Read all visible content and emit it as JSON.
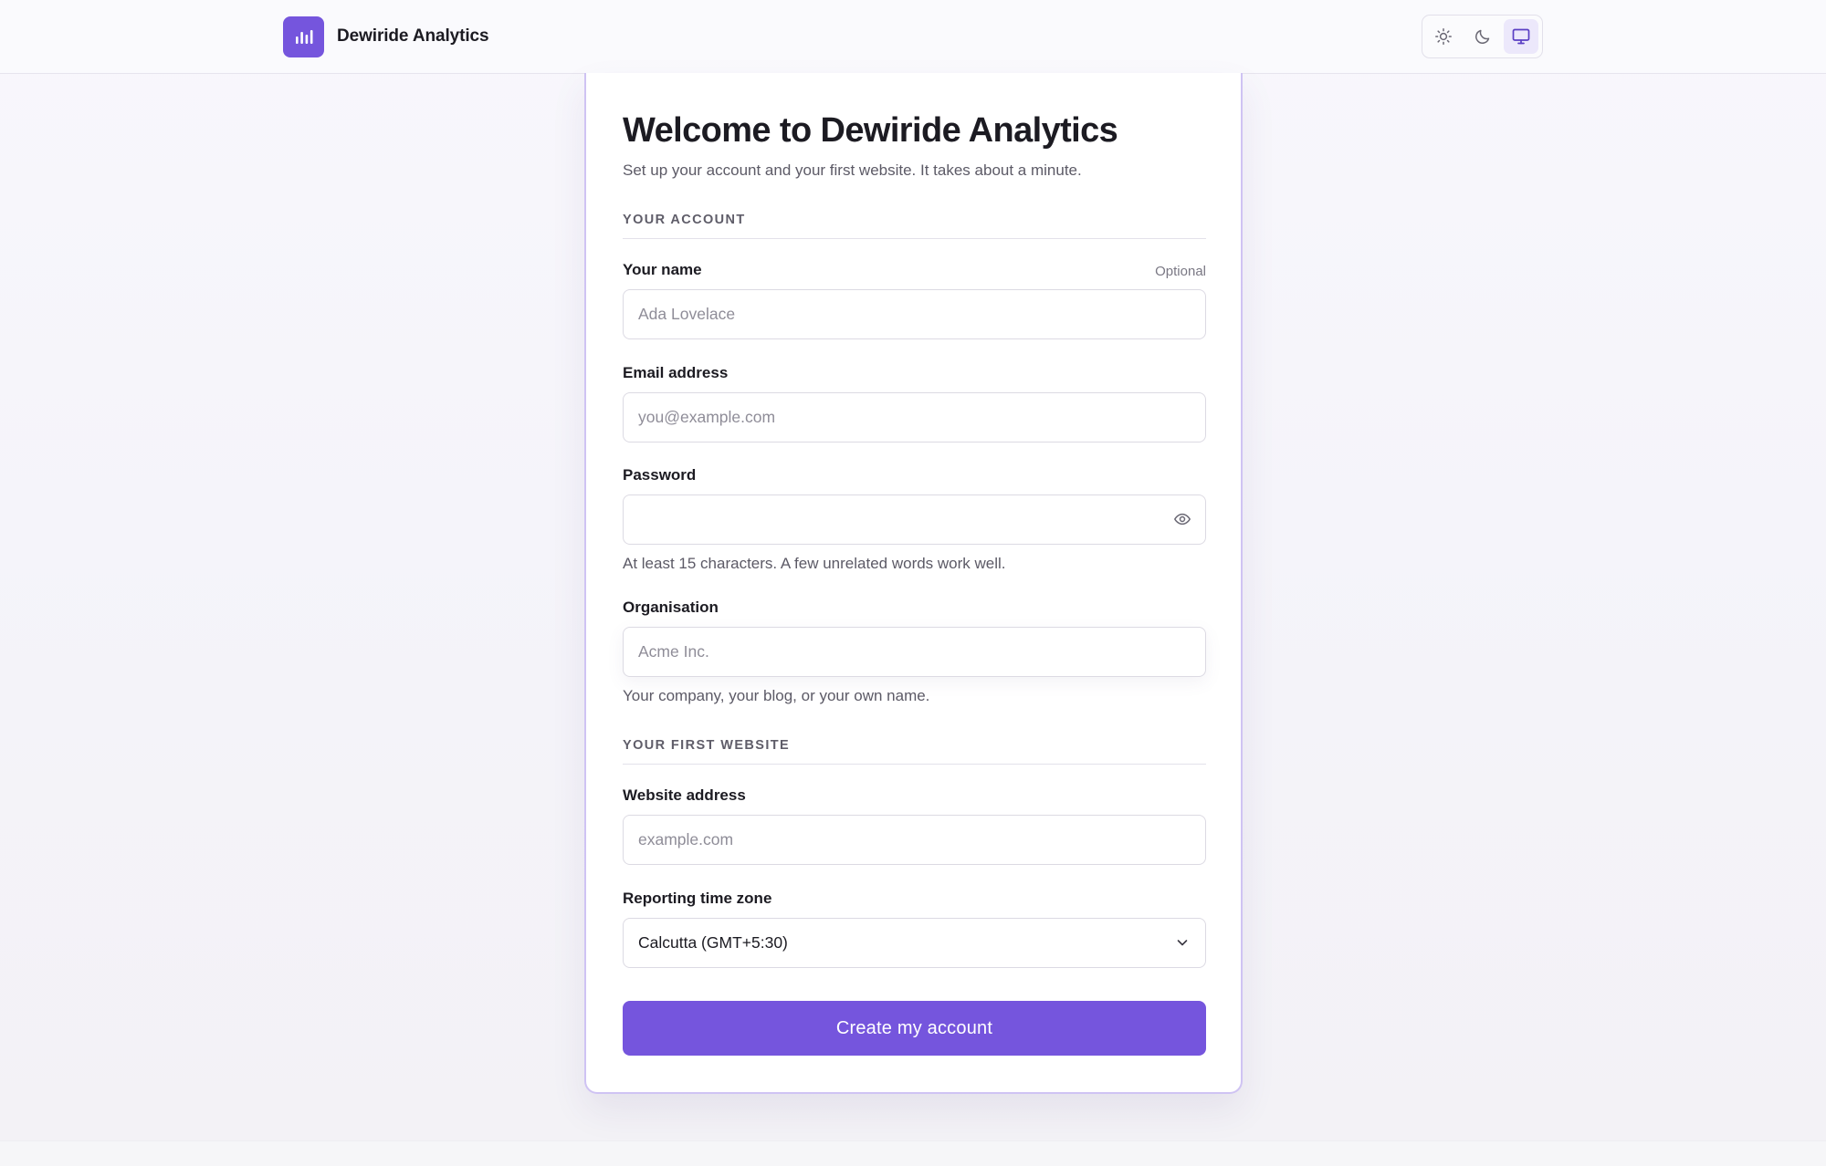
{
  "header": {
    "brand_name": "Dewiride Analytics",
    "logo_icon": "bar-chart-icon",
    "theme_options": [
      {
        "name": "light",
        "icon": "sun-icon"
      },
      {
        "name": "dark",
        "icon": "moon-icon"
      },
      {
        "name": "system",
        "icon": "monitor-icon",
        "active": true
      }
    ]
  },
  "form": {
    "title": "Welcome to Dewiride Analytics",
    "subtitle": "Set up your account and your first website. It takes about a minute.",
    "section_account": "YOUR ACCOUNT",
    "name_label": "Your name",
    "name_optional": "Optional",
    "name_placeholder": "Ada Lovelace",
    "name_value": "",
    "email_label": "Email address",
    "email_placeholder": "you@example.com",
    "email_value": "",
    "password_label": "Password",
    "password_value": "",
    "password_hint": "At least 15 characters. A few unrelated words work well.",
    "org_label": "Organisation",
    "org_placeholder": "Acme Inc.",
    "org_value": "",
    "org_hint": "Your company, your blog, or your own name.",
    "section_website": "YOUR FIRST WEBSITE",
    "website_label": "Website address",
    "website_placeholder": "example.com",
    "website_value": "",
    "timezone_label": "Reporting time zone",
    "timezone_value": "Calcutta (GMT+5:30)",
    "submit_label": "Create my account"
  },
  "colors": {
    "accent": "#7555dd",
    "card_border": "#cfc3f3",
    "background": "#f6f5fa"
  }
}
